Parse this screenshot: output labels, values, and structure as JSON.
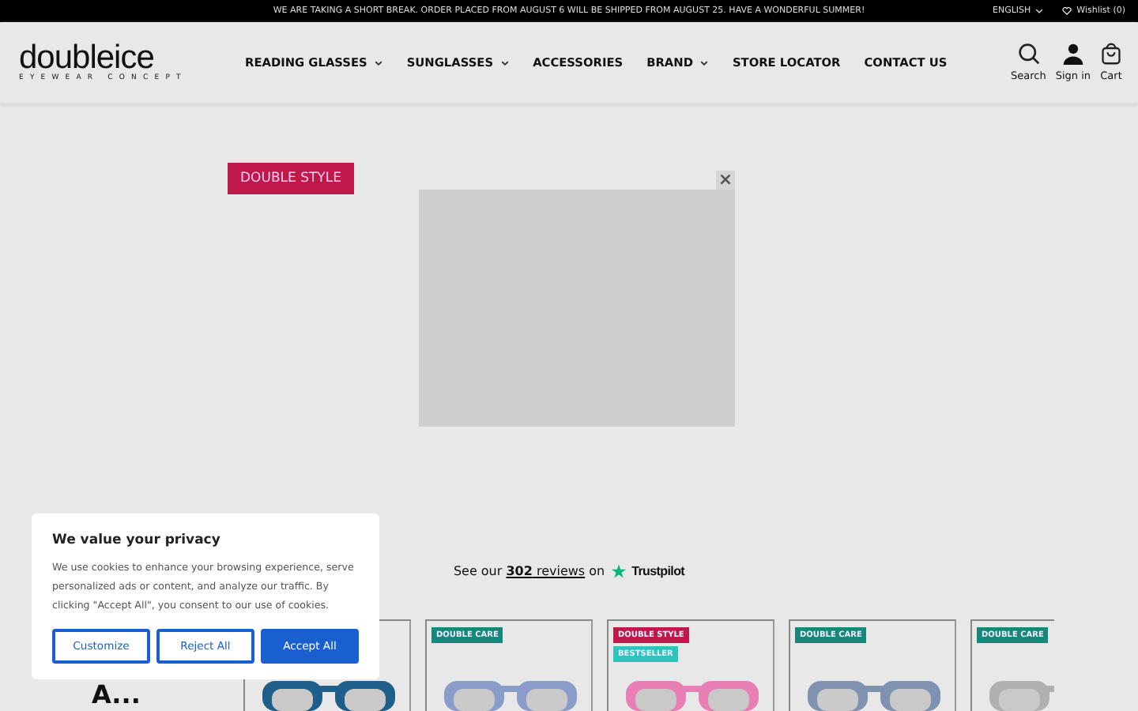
{
  "announcement": "WE ARE TAKING A SHORT BREAK. ORDER PLACED FROM AUGUST 6 WILL BE SHIPPED FROM AUGUST 25. HAVE A WONDERFUL SUMMER!",
  "language": "ENGLISH",
  "wishlist": "Wishlist (0)",
  "logo": {
    "name": "doubleice",
    "tagline": "EYEWEAR CONCEPT"
  },
  "nav": [
    {
      "label": "READING GLASSES",
      "dropdown": true
    },
    {
      "label": "SUNGLASSES",
      "dropdown": true
    },
    {
      "label": "ACCESSORIES",
      "dropdown": false
    },
    {
      "label": "BRAND",
      "dropdown": true
    },
    {
      "label": "STORE LOCATOR",
      "dropdown": false
    },
    {
      "label": "CONTACT US",
      "dropdown": false
    }
  ],
  "actions": [
    {
      "kind": "search",
      "label": "Search"
    },
    {
      "kind": "account",
      "label": "Sign in"
    },
    {
      "kind": "cart",
      "label": "Cart"
    }
  ],
  "hero_badge": "DOUBLE STYLE",
  "popup_close": "×",
  "reviews": {
    "prefix": "See our",
    "count": "302",
    "link": "reviews",
    "middle": "on",
    "brand": "Trustpilot"
  },
  "heading": "A...",
  "products": [
    {
      "kind": "picture"
    },
    {
      "kind": "picture",
      "badges": [
        {
          "label": "DOUBLE CARE",
          "color": "#16877a"
        }
      ]
    },
    {
      "kind": "picture",
      "badges": [
        {
          "label": "DOUBLE STYLE",
          "color": "#c0184a"
        },
        {
          "label": "BESTSELLER",
          "color": "#2ec4bd"
        }
      ]
    },
    {
      "kind": "picture",
      "badges": [
        {
          "label": "DOUBLE CARE",
          "color": "#16877a"
        }
      ]
    },
    {
      "kind": "picture",
      "badges": [
        {
          "label": "DOUBLE CARE",
          "color": "#16877a"
        }
      ]
    }
  ],
  "cookie": {
    "title": "We value your privacy",
    "text": "We use cookies to enhance your browsing experience, serve personalized ads or content, and analyze our traffic. By clicking \"Accept All\", you consent to our use of cookies.",
    "buttons": [
      {
        "label": "Customize",
        "kind": "secondary"
      },
      {
        "label": "Reject All",
        "kind": "secondary"
      },
      {
        "label": "Accept All",
        "kind": "primary"
      }
    ]
  }
}
